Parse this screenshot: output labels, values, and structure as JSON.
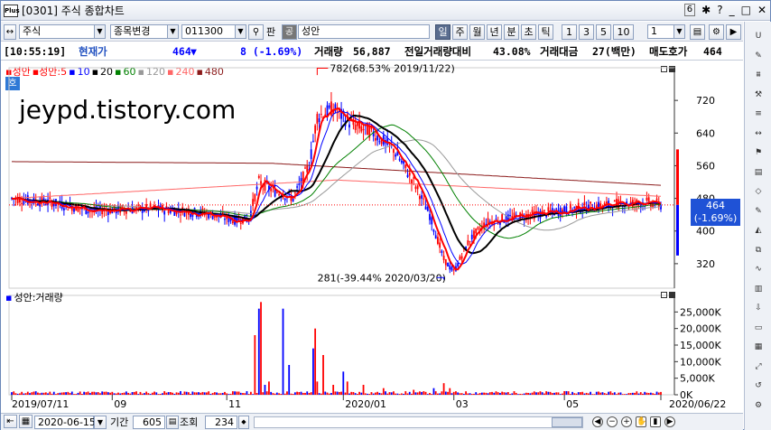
{
  "window": {
    "logo": "Plus",
    "title": "[0301] 주식 종합차트",
    "page_num": "6",
    "icons": [
      "pin-icon",
      "help-icon",
      "minimize-icon",
      "maximize-icon",
      "close-icon"
    ],
    "glyphs": {
      "pin": "✱",
      "help": "?",
      "min": "_",
      "max": "□",
      "close": "✕"
    }
  },
  "toolbar": {
    "market": "주식",
    "mode": "종목변경",
    "code": "011300",
    "pan_label": "판",
    "share_label": "공",
    "name": "성안",
    "periods": [
      "일",
      "주",
      "월",
      "년",
      "분",
      "초",
      "틱",
      "1",
      "3",
      "5",
      "10"
    ],
    "active_period": "일",
    "count": "1"
  },
  "status": {
    "time": "[10:55:19]",
    "price_label": "현재가",
    "price": "464",
    "direction": "▼",
    "change": "8 (-1.69%)",
    "volume_label": "거래량",
    "volume": "56,887",
    "ratio_label": "전일거래량대비",
    "ratio": "43.08%",
    "amount_label": "거래대금",
    "amount": "27(백만)",
    "ask_label": "매도호가",
    "ask": "464"
  },
  "price_pane": {
    "legend": [
      {
        "text": "성안",
        "color": "#ff0000"
      },
      {
        "text": "성안:5",
        "color": "#ff0000"
      },
      {
        "text": "10",
        "color": "#0000ff"
      },
      {
        "text": "20",
        "color": "#000000"
      },
      {
        "text": "60",
        "color": "#008000"
      },
      {
        "text": "120",
        "color": "#999999"
      },
      {
        "text": "240",
        "color": "#ff6666"
      },
      {
        "text": "480",
        "color": "#8b1a1a"
      }
    ],
    "watermark": "jeypd.tistory.com",
    "hogi_label": "호",
    "high_annotation": "782(68.53% 2019/11/22)",
    "low_annotation": "281(-39.44% 2020/03/20)",
    "current_price": "464",
    "current_change": "(-1.69%)",
    "y_ticks": [
      "720",
      "640",
      "560",
      "480",
      "400",
      "320"
    ]
  },
  "volume_pane": {
    "legend": "성안:거래량",
    "y_ticks": [
      "25,000K",
      "20,000K",
      "15,000K",
      "10,000K",
      "5,000K",
      "0K"
    ]
  },
  "x_axis": {
    "labels": [
      "2019/07/11",
      "09",
      "11",
      "2020/01",
      "03",
      "05",
      "2020/06/22"
    ]
  },
  "bottom": {
    "date": "2020-06-15",
    "period_label": "기간",
    "period_value": "605",
    "view_label": "조회",
    "view_value": "234"
  },
  "sidebar": {
    "buttons": [
      "U",
      "TOOL",
      "",
      "기계",
      "",
      "",
      "",
      "",
      "",
      "",
      "",
      "",
      "",
      "",
      "",
      "",
      "",
      "",
      "",
      ""
    ]
  },
  "colors": {
    "up": "#ff0000",
    "down": "#0000ff",
    "ma20": "#000000",
    "ma60": "#008000",
    "ma120": "#999999",
    "ma240": "#ff6666",
    "ma480": "#8b1a1a",
    "accent": "#2050c0"
  }
}
